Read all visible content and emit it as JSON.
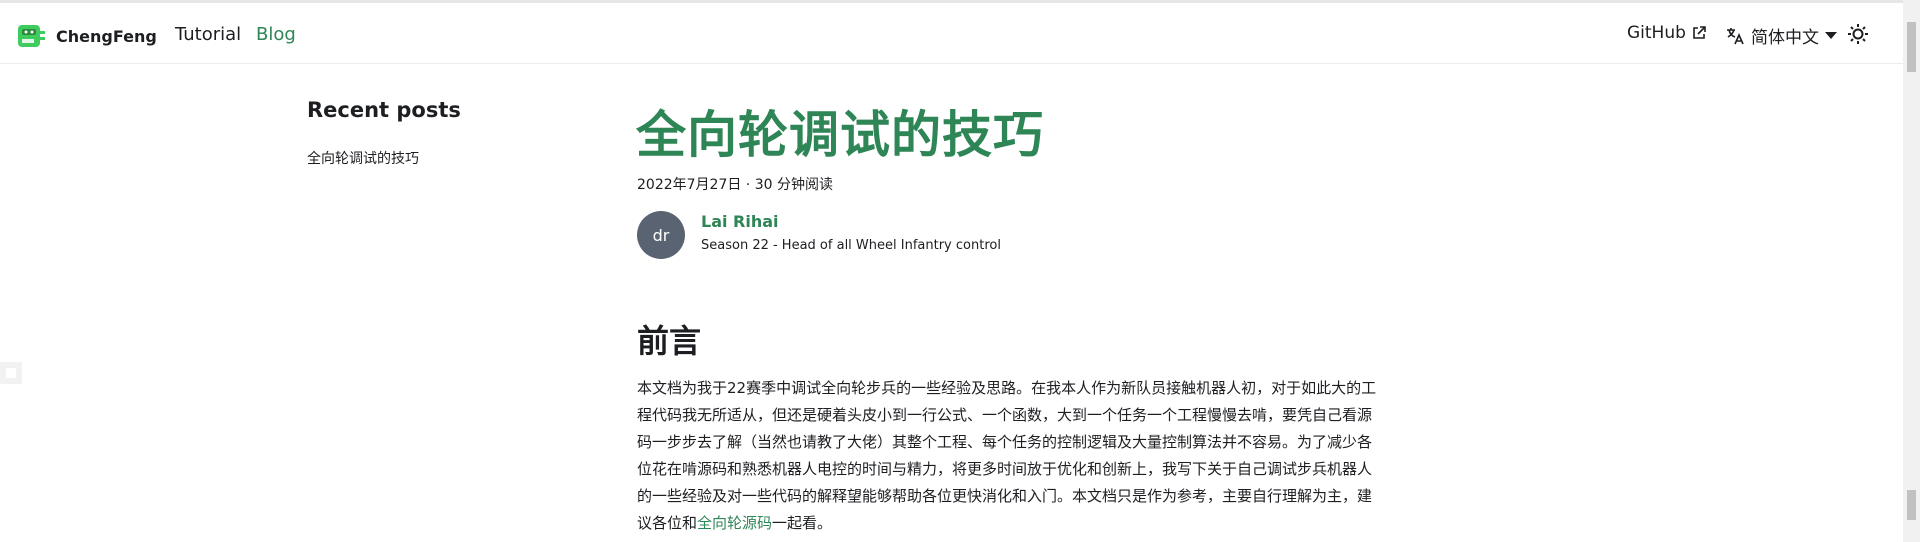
{
  "navbar": {
    "brand_title": "ChengFeng",
    "links": [
      {
        "label": "Tutorial",
        "active": false
      },
      {
        "label": "Blog",
        "active": true
      }
    ],
    "github_label": "GitHub",
    "language_label": "简体中文"
  },
  "sidebar": {
    "title": "Recent posts",
    "posts": [
      "全向轮调试的技巧"
    ]
  },
  "post": {
    "title": "全向轮调试的技巧",
    "meta": "2022年7月27日 · 30 分钟阅读",
    "author": {
      "initials": "dr",
      "name": "Lai Rihai",
      "title": "Season 22 - Head of all Wheel Infantry control"
    },
    "section_heading": "前言",
    "paragraph_before_link": "本文档为我于22赛季中调试全向轮步兵的一些经验及思路。在我本人作为新队员接触机器人初，对于如此大的工程代码我无所适从，但还是硬着头皮小到一行公式、一个函数，大到一个任务一个工程慢慢去啃，要凭自己看源码一步步去了解（当然也请教了大佬）其整个工程、每个任务的控制逻辑及大量控制算法并不容易。为了减少各位花在啃源码和熟悉机器人电控的时间与精力，将更多时间放于优化和创新上，我写下关于自己调试步兵机器人的一些经验及对一些代码的解释望能够帮助各位更快消化和入门。本文档只是作为参考，主要自行理解为主，建议各位和",
    "link_text": "全向轮源码",
    "paragraph_after_link": "一起看。"
  },
  "colors": {
    "accent": "#2e8555",
    "avatar_bg": "#5a6372"
  }
}
